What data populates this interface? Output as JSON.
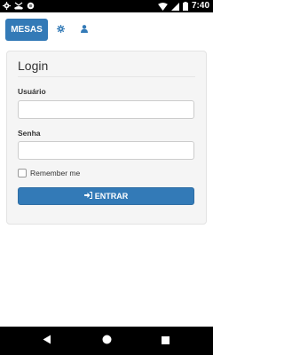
{
  "status_bar": {
    "time": "7:40",
    "icons": [
      "gear-icon",
      "missed-call-icon",
      "circle-icon",
      "wifi-icon",
      "signal-icon",
      "battery-icon"
    ]
  },
  "tabs": {
    "mesas_label": "MESAS",
    "settings_icon": "gear-icon",
    "user_icon": "user-icon"
  },
  "login": {
    "title": "Login",
    "user_label": "Usuário",
    "user_value": "",
    "password_label": "Senha",
    "password_value": "",
    "remember_label": "Remember me",
    "remember_checked": false,
    "submit_label": "ENTRAR",
    "submit_icon": "sign-in-icon"
  },
  "android_nav": {
    "back": "back-icon",
    "home": "home-icon",
    "recents": "recents-icon"
  },
  "colors": {
    "primary": "#337ab7",
    "panel_bg": "#f5f5f5"
  }
}
